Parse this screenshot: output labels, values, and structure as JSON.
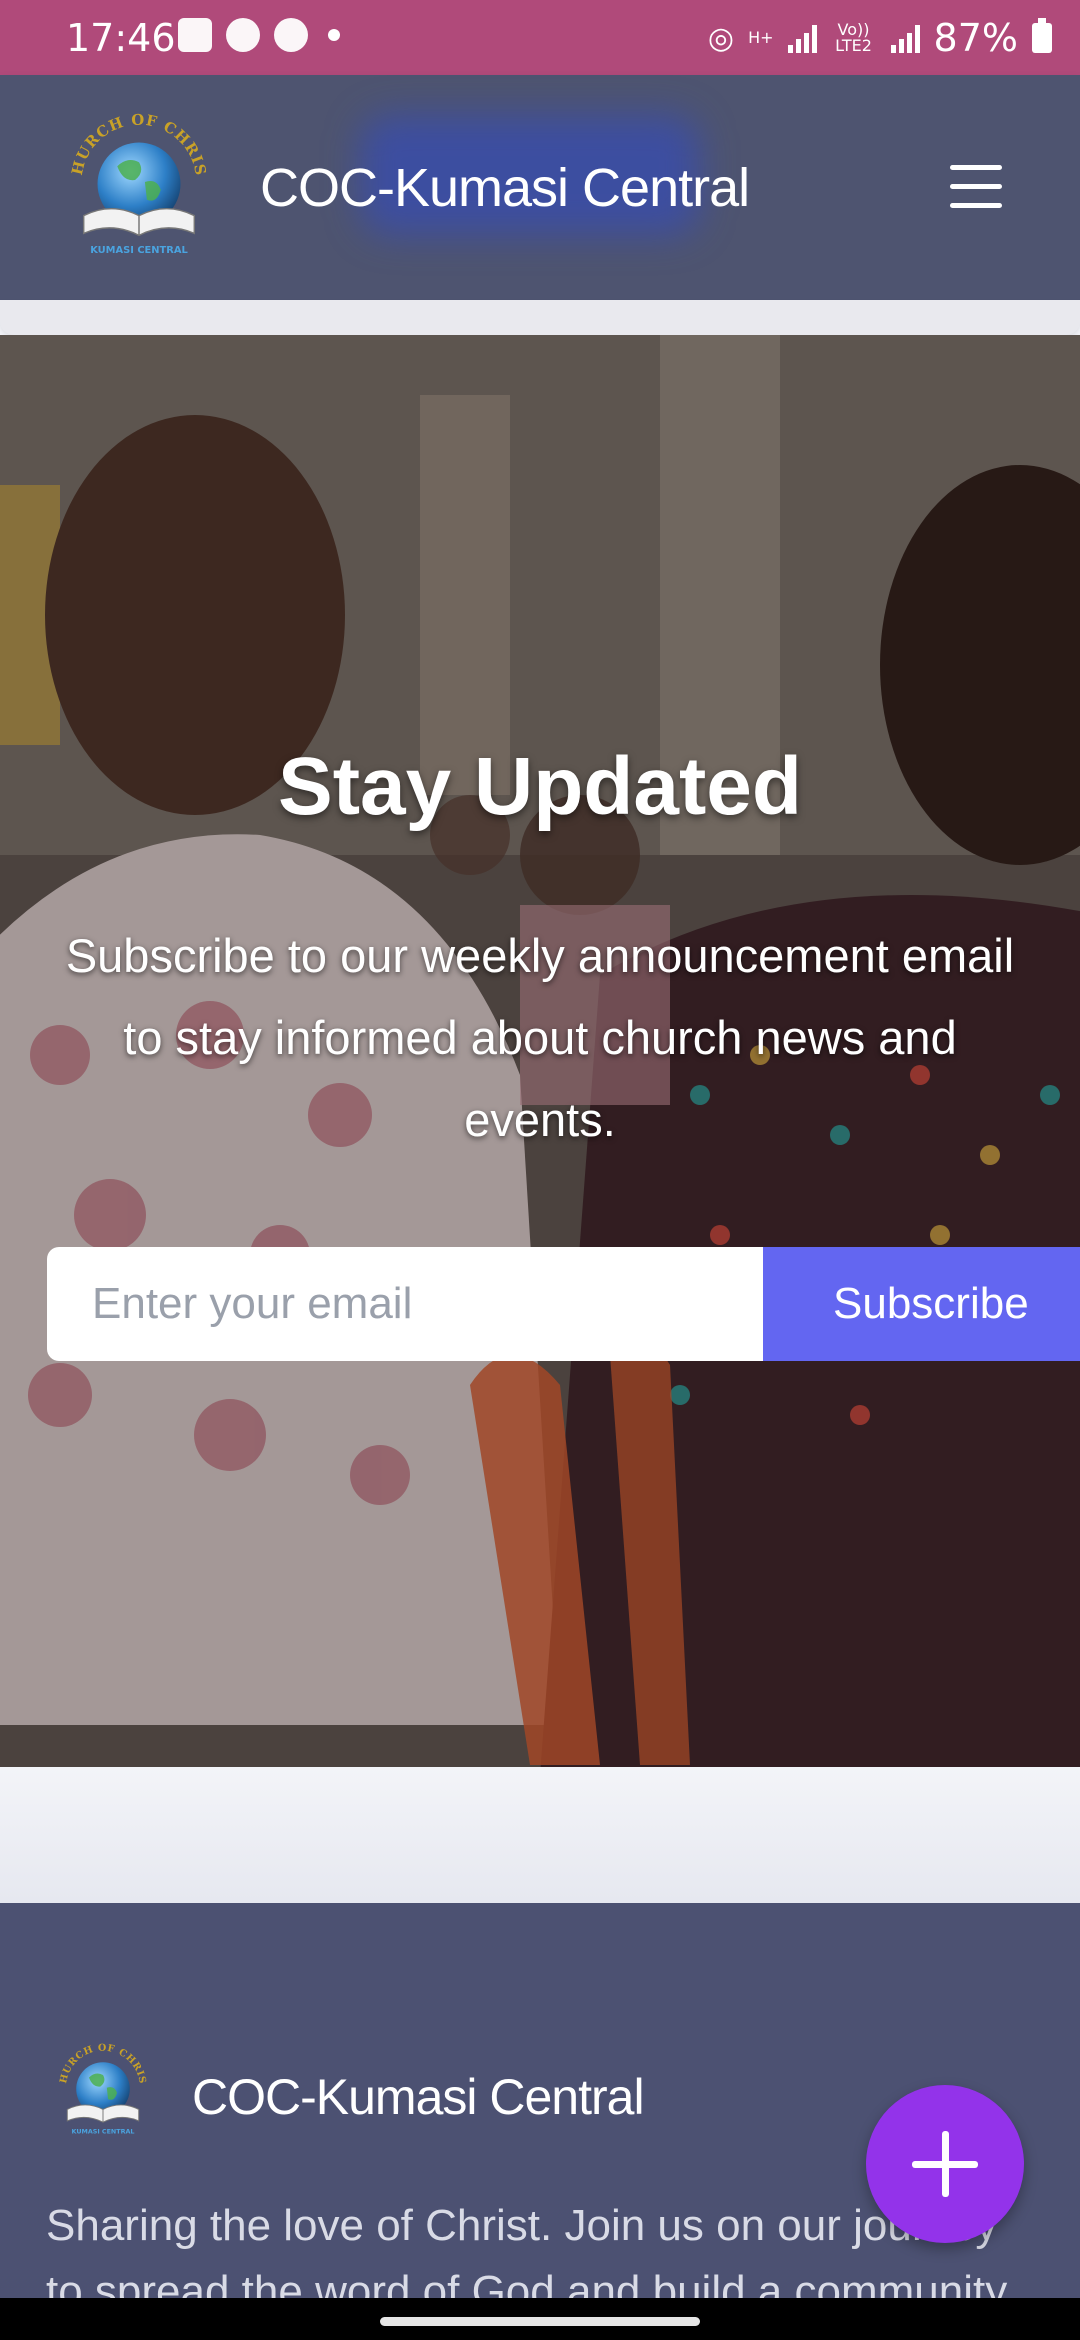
{
  "status_bar": {
    "time": "17:46",
    "battery": "87%",
    "network_tag_1": "H+",
    "network_tag_2": "Vo)) LTE2"
  },
  "header": {
    "title": "COC-Kumasi Central",
    "logo": {
      "arc_text": "CHURCH OF CHRIST",
      "base_text": "KUMASI CENTRAL"
    },
    "menu_icon": "hamburger-menu-icon"
  },
  "hero": {
    "title": "Stay Updated",
    "description": "Subscribe to our weekly announcement email to stay informed about church news and events.",
    "email_placeholder": "Enter your email",
    "subscribe_label": "Subscribe"
  },
  "footer": {
    "brand": "COC-Kumasi Central",
    "logo": {
      "arc_text": "CHURCH OF CHRIST",
      "base_text": "KUMASI CENTRAL"
    },
    "text": "Sharing the love of Christ. Join us on our journey to spread the word of God and build a community"
  },
  "fab": {
    "icon": "plus-icon"
  },
  "colors": {
    "status_bar": "#b04a7a",
    "header": "#4e5470",
    "subscribe_button": "#6366f1",
    "fab": "#9333ea",
    "footer": "#4c5172"
  }
}
